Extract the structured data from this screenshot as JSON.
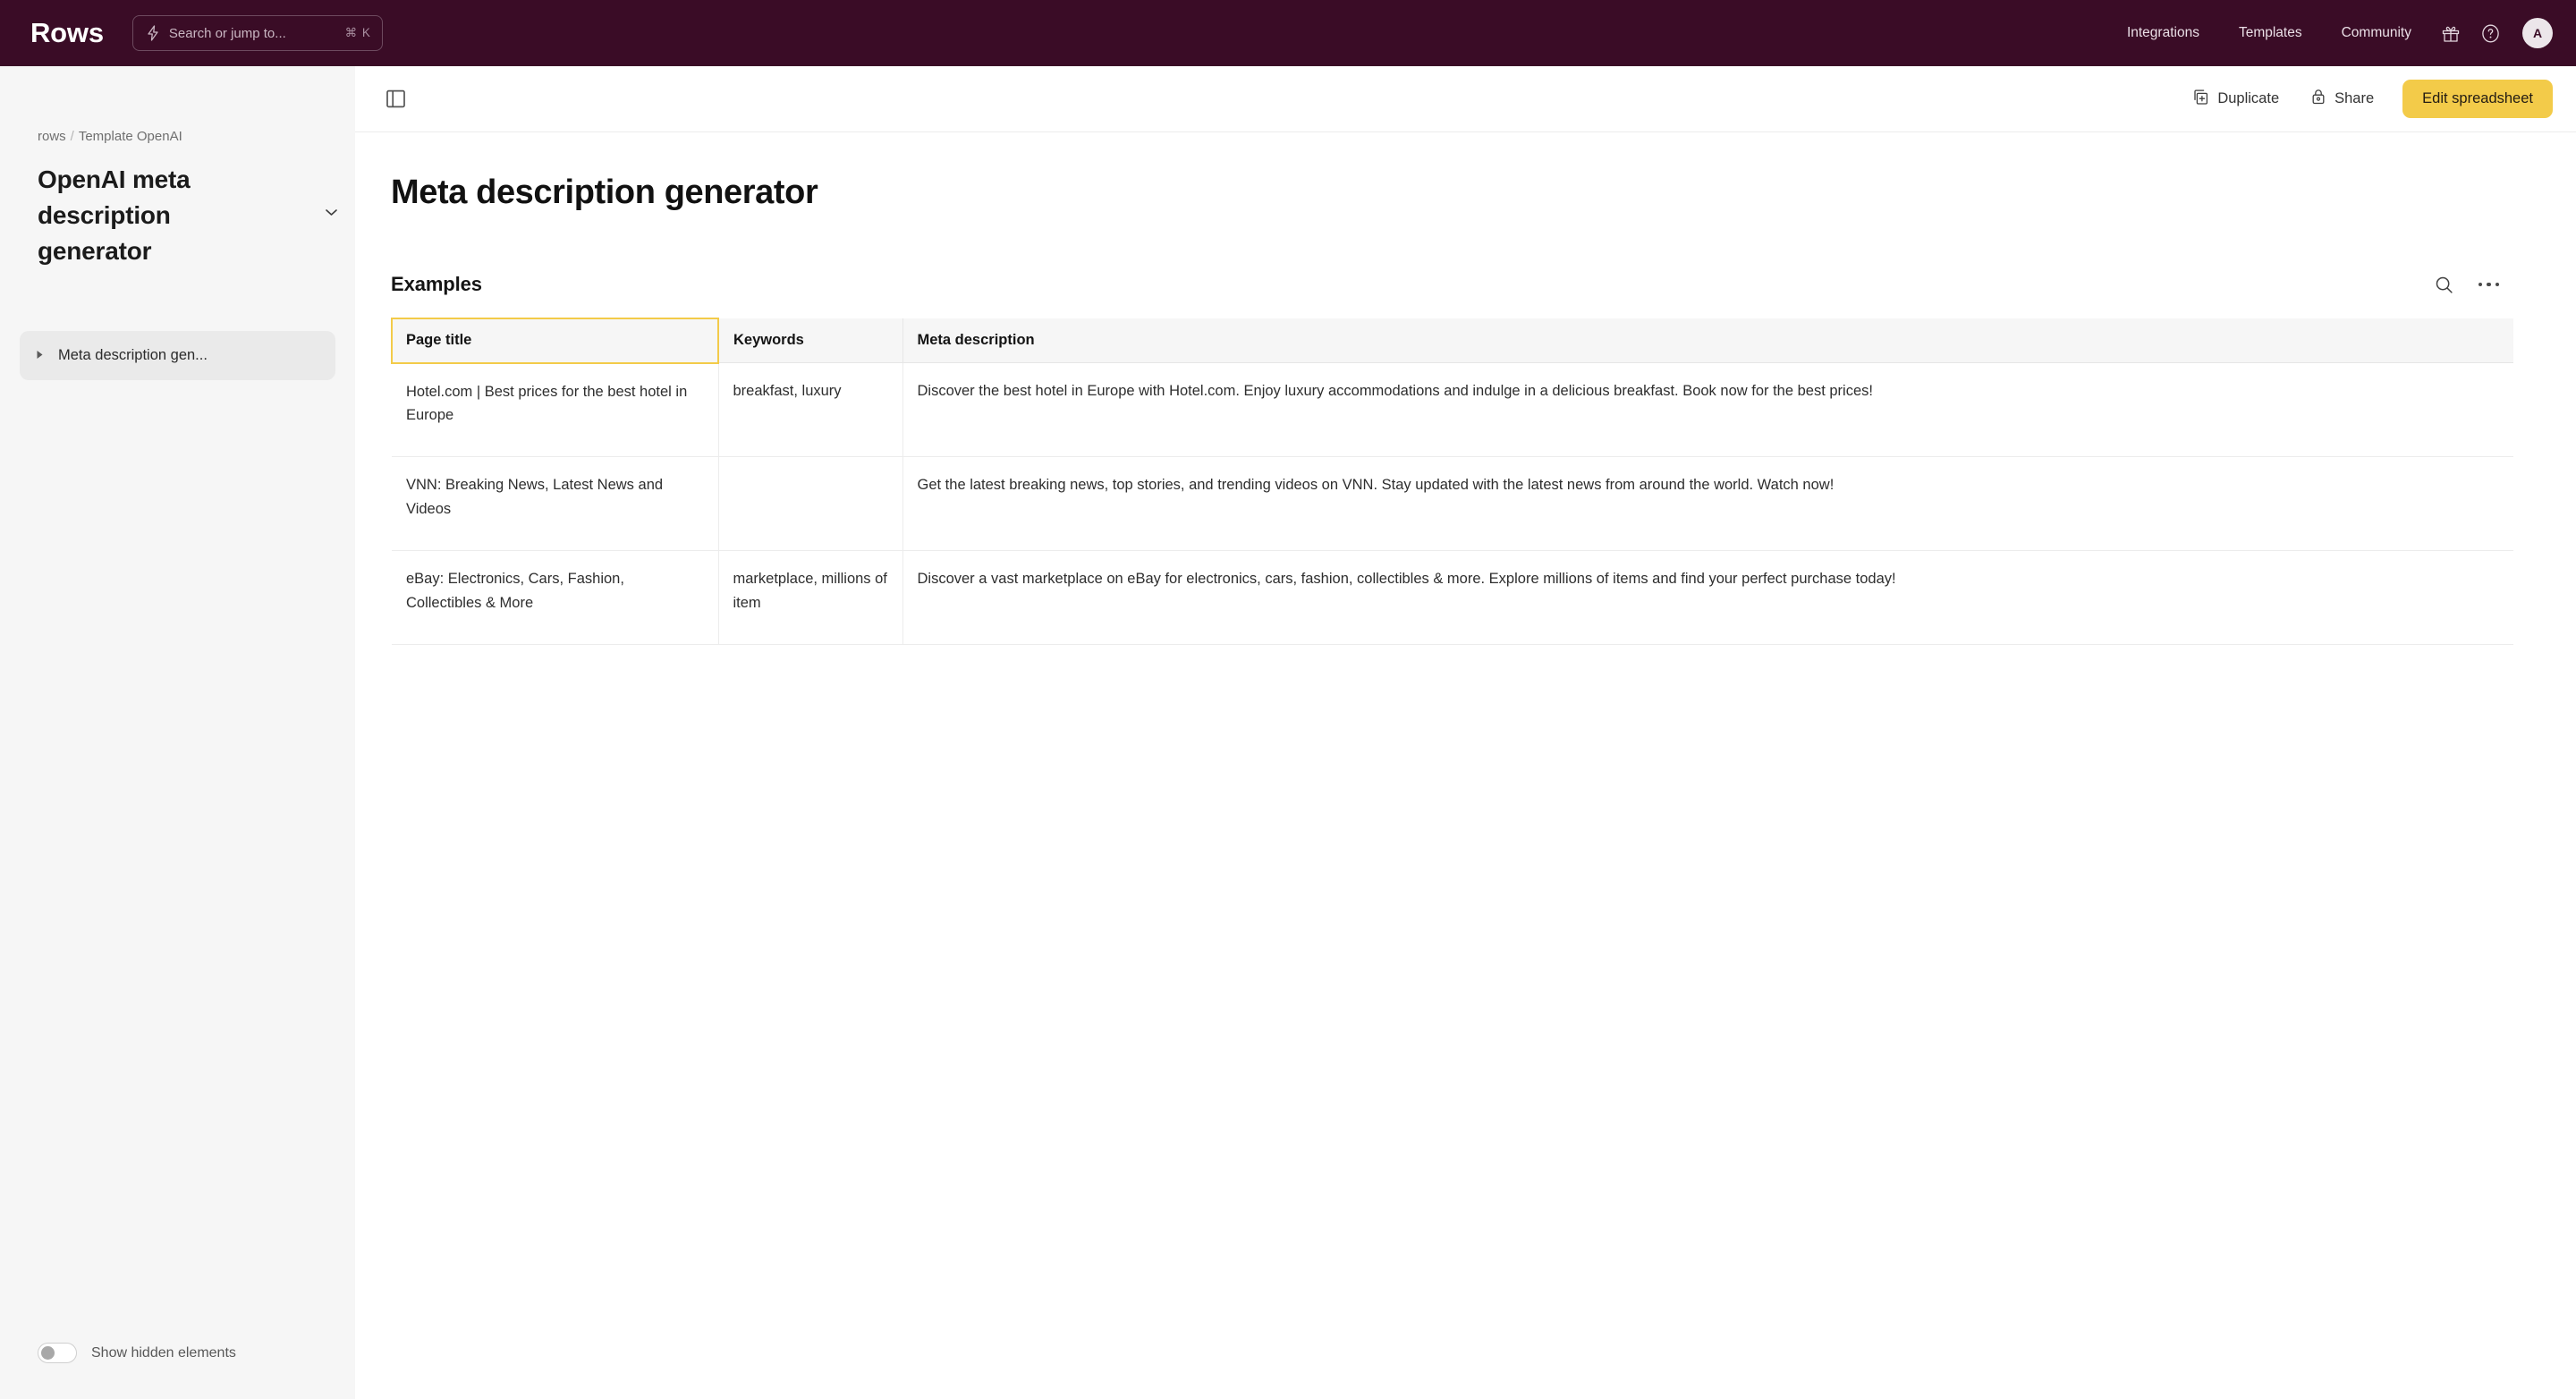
{
  "topnav": {
    "brand": "Rows",
    "search": {
      "placeholder": "Search or jump to...",
      "shortcut": "⌘ K",
      "icon": "lightning-bolt-icon"
    },
    "links": [
      {
        "label": "Integrations"
      },
      {
        "label": "Templates"
      },
      {
        "label": "Community"
      }
    ],
    "gift_icon": "gift-icon",
    "help_icon": "help-circle-icon",
    "avatar_initial": "A",
    "background_color": "#3A0C26"
  },
  "sidebar": {
    "breadcrumb": {
      "root": "rows",
      "separator": "/",
      "current": "Template OpenAI"
    },
    "document_title": "OpenAI meta description generator",
    "tree_items": [
      {
        "label": "Meta description gen...",
        "expanded": false
      }
    ],
    "footer_toggle": {
      "label": "Show hidden elements",
      "on": false
    },
    "background_color": "#F6F6F6"
  },
  "toolbar": {
    "panel_toggle_icon": "sidebar-panel-icon",
    "duplicate_label": "Duplicate",
    "duplicate_icon": "copy-icon",
    "share_label": "Share",
    "share_icon": "lock-icon",
    "edit_label": "Edit spreadsheet",
    "edit_color": "#F3CB49"
  },
  "main": {
    "page_title": "Meta description generator",
    "section": {
      "title": "Examples",
      "search_icon": "search-icon",
      "more_icon": "more-horizontal-icon"
    },
    "table": {
      "selected_header_index": 0,
      "selection_color": "#F3CB49",
      "columns": [
        "Page title",
        "Keywords",
        "Meta description"
      ],
      "rows": [
        {
          "page_title": "Hotel.com | Best prices for the best hotel in Europe",
          "keywords": "breakfast, luxury",
          "meta_description": "Discover the best hotel in Europe with Hotel.com. Enjoy luxury accommodations and indulge in a delicious breakfast. Book now for the best prices!"
        },
        {
          "page_title": "VNN: Breaking News, Latest News and Videos",
          "keywords": "",
          "meta_description": "Get the latest breaking news, top stories, and trending videos on VNN. Stay updated with the latest news from around the world. Watch now!"
        },
        {
          "page_title": "eBay: Electronics, Cars, Fashion, Collectibles & More",
          "keywords": "marketplace, millions of item",
          "meta_description": "Discover a vast marketplace on eBay for electronics, cars, fashion, collectibles & more. Explore millions of items and find your perfect purchase today!"
        }
      ]
    }
  }
}
